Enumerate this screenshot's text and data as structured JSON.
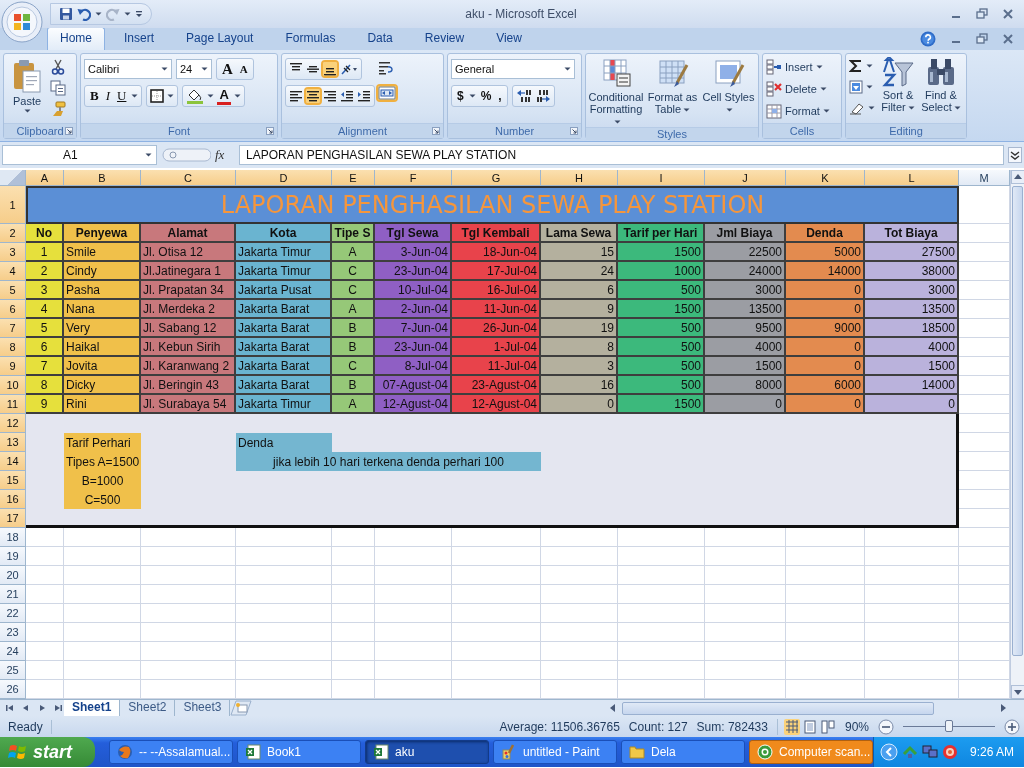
{
  "window": {
    "title": "aku - Microsoft Excel"
  },
  "tabs": [
    {
      "label": "Home",
      "selected": true
    },
    {
      "label": "Insert",
      "selected": false
    },
    {
      "label": "Page Layout",
      "selected": false
    },
    {
      "label": "Formulas",
      "selected": false
    },
    {
      "label": "Data",
      "selected": false
    },
    {
      "label": "Review",
      "selected": false
    },
    {
      "label": "View",
      "selected": false
    }
  ],
  "ribbon": {
    "groups": [
      {
        "kind": "clipboard",
        "label": "Clipboard",
        "paste": "Paste"
      },
      {
        "kind": "font",
        "label": "Font",
        "font_name": "Calibri",
        "font_size": "24",
        "grow": "A",
        "shrink": "A",
        "styles": [
          "B",
          "I",
          "U"
        ],
        "font_color": "A"
      },
      {
        "kind": "alignment",
        "label": "Alignment",
        "rows": [
          [
            {
              "kind": "top",
              "selected": false
            },
            {
              "kind": "middle",
              "selected": false
            },
            {
              "kind": "bottom",
              "selected": true
            },
            {
              "kind": "orientation",
              "selected": false
            }
          ],
          [
            {
              "kind": "left",
              "selected": false
            },
            {
              "kind": "center",
              "selected": true
            },
            {
              "kind": "right",
              "selected": false
            },
            {
              "kind": "outdent",
              "selected": false
            },
            {
              "kind": "indent",
              "selected": false
            }
          ]
        ],
        "side": [
          {
            "kind": "wrap",
            "selected": false
          },
          {
            "kind": "merge",
            "selected": true
          }
        ]
      },
      {
        "kind": "number",
        "label": "Number",
        "format": "General",
        "symbols": [
          "$",
          "%",
          ","
        ]
      },
      {
        "kind": "styles",
        "label": "Styles",
        "buttons": [
          {
            "kind": "conditional",
            "label": "Conditional Formatting"
          },
          {
            "kind": "table",
            "label": "Format as Table"
          },
          {
            "kind": "cellstyle",
            "label": "Cell Styles"
          }
        ]
      },
      {
        "kind": "cells",
        "label": "Cells",
        "buttons": [
          {
            "kind": "insert",
            "label": "Insert"
          },
          {
            "kind": "delete",
            "label": "Delete"
          },
          {
            "kind": "format",
            "label": "Format"
          }
        ]
      },
      {
        "kind": "editing",
        "label": "Editing",
        "buttons": [
          {
            "kind": "sort",
            "label": "Sort & Filter"
          },
          {
            "kind": "find",
            "label": "Find & Select"
          }
        ]
      }
    ]
  },
  "formula_bar": {
    "name_box": "A1",
    "function_label": "fx",
    "formula": "LAPORAN PENGHASILAN SEWA PLAY STATION"
  },
  "sheet": {
    "columns": [
      {
        "label": "A",
        "highlighted": true
      },
      {
        "label": "B",
        "highlighted": true
      },
      {
        "label": "C",
        "highlighted": true
      },
      {
        "label": "D",
        "highlighted": true
      },
      {
        "label": "E",
        "highlighted": true
      },
      {
        "label": "F",
        "highlighted": true
      },
      {
        "label": "G",
        "highlighted": true
      },
      {
        "label": "H",
        "highlighted": true
      },
      {
        "label": "I",
        "highlighted": true
      },
      {
        "label": "J",
        "highlighted": true
      },
      {
        "label": "K",
        "highlighted": true
      },
      {
        "label": "L",
        "highlighted": true
      },
      {
        "label": "M",
        "highlighted": false
      }
    ],
    "rows": [
      {
        "label": "1",
        "highlighted": true
      },
      {
        "label": "2",
        "highlighted": true
      },
      {
        "label": "3",
        "highlighted": true
      },
      {
        "label": "4",
        "highlighted": true
      },
      {
        "label": "5",
        "highlighted": true
      },
      {
        "label": "6",
        "highlighted": true
      },
      {
        "label": "7",
        "highlighted": true
      },
      {
        "label": "8",
        "highlighted": true
      },
      {
        "label": "9",
        "highlighted": true
      },
      {
        "label": "10",
        "highlighted": true
      },
      {
        "label": "11",
        "highlighted": true
      },
      {
        "label": "12",
        "highlighted": true
      },
      {
        "label": "13",
        "highlighted": true
      },
      {
        "label": "14",
        "highlighted": true
      },
      {
        "label": "15",
        "highlighted": true
      },
      {
        "label": "16",
        "highlighted": true
      },
      {
        "label": "17",
        "highlighted": true
      },
      {
        "label": "18",
        "highlighted": false
      },
      {
        "label": "19",
        "highlighted": false
      },
      {
        "label": "20",
        "highlighted": false
      },
      {
        "label": "21",
        "highlighted": false
      },
      {
        "label": "22",
        "highlighted": false
      },
      {
        "label": "23",
        "highlighted": false
      },
      {
        "label": "24",
        "highlighted": false
      },
      {
        "label": "25",
        "highlighted": false
      },
      {
        "label": "26",
        "highlighted": false
      }
    ],
    "title": "LAPORAN PENGHASILAN SEWA PLAY STATION",
    "table": {
      "columns": [
        {
          "header": "No",
          "color": "#e6e03c",
          "kind": "index"
        },
        {
          "header": "Penyewa",
          "color": "#f0c04a",
          "kind": "text"
        },
        {
          "header": "Alamat",
          "color": "#c8787c",
          "kind": "text"
        },
        {
          "header": "Kota",
          "color": "#6ab4d0",
          "kind": "text"
        },
        {
          "header": "Tipe S",
          "color": "#96c878",
          "kind": "code"
        },
        {
          "header": "Tgl Sewa",
          "color": "#8f5fc4",
          "kind": "date"
        },
        {
          "header": "Tgl Kembali",
          "color": "#e8434b",
          "kind": "date"
        },
        {
          "header": "Lama Sewa",
          "color": "#b4b09e",
          "kind": "number"
        },
        {
          "header": "Tarif per Hari",
          "color": "#3cb97c",
          "kind": "number"
        },
        {
          "header": "Jml Biaya",
          "color": "#9b9da3",
          "kind": "number"
        },
        {
          "header": "Denda",
          "color": "#e38b4f",
          "kind": "number"
        },
        {
          "header": "Tot Biaya",
          "color": "#bab2dc",
          "kind": "number"
        }
      ],
      "rows": [
        [
          "1",
          "Smile",
          "Jl. Otisa 12",
          "Jakarta Timur",
          "A",
          "3-Jun-04",
          "18-Jun-04",
          "15",
          "1500",
          "22500",
          "5000",
          "27500"
        ],
        [
          "2",
          "Cindy",
          "Jl.Jatinegara 1",
          "Jakarta Timur",
          "C",
          "23-Jun-04",
          "17-Jul-04",
          "24",
          "1000",
          "24000",
          "14000",
          "38000"
        ],
        [
          "3",
          "Pasha",
          "Jl. Prapatan 34",
          "Jakarta Pusat",
          "C",
          "10-Jul-04",
          "16-Jul-04",
          "6",
          "500",
          "3000",
          "0",
          "3000"
        ],
        [
          "4",
          "Nana",
          "Jl. Merdeka 2",
          "Jakarta Barat",
          "A",
          "2-Jun-04",
          "11-Jun-04",
          "9",
          "1500",
          "13500",
          "0",
          "13500"
        ],
        [
          "5",
          "Very",
          "Jl. Sabang 12",
          "Jakarta Barat",
          "B",
          "7-Jun-04",
          "26-Jun-04",
          "19",
          "500",
          "9500",
          "9000",
          "18500"
        ],
        [
          "6",
          "Haikal",
          "Jl. Kebun Sirih",
          "Jakarta Barat",
          "B",
          "23-Jun-04",
          "1-Jul-04",
          "8",
          "500",
          "4000",
          "0",
          "4000"
        ],
        [
          "7",
          "Jovita",
          "Jl. Karanwang 2",
          "Jakarta Barat",
          "C",
          "8-Jul-04",
          "11-Jul-04",
          "3",
          "500",
          "1500",
          "0",
          "1500"
        ],
        [
          "8",
          "Dicky",
          "Jl. Beringin 43",
          "Jakarta Barat",
          "B",
          "07-Agust-04",
          "23-Agust-04",
          "16",
          "500",
          "8000",
          "6000",
          "14000"
        ],
        [
          "9",
          "Rini",
          "Jl. Surabaya 54",
          "Jakarta Timur",
          "A",
          "12-Agust-04",
          "12-Agust-04",
          "0",
          "1500",
          "0",
          "0",
          "0"
        ]
      ]
    },
    "rate_note": {
      "title": "Tarif Perhari",
      "lines": [
        "Tipes A=1500",
        "B=1000",
        "C=500"
      ]
    },
    "fine_note": {
      "title": "Denda",
      "text": "jika lebih 10 hari terkena denda perhari 100"
    }
  },
  "sheet_tabs": [
    {
      "label": "Sheet1",
      "selected": true
    },
    {
      "label": "Sheet2",
      "selected": false
    },
    {
      "label": "Sheet3",
      "selected": false
    }
  ],
  "status_bar": {
    "mode": "Ready",
    "average": "Average: 11506.36765",
    "count": "Count: 127",
    "sum": "Sum: 782433",
    "views": [
      {
        "kind": "normal",
        "selected": true
      },
      {
        "kind": "layout",
        "selected": false
      },
      {
        "kind": "break",
        "selected": false
      }
    ],
    "zoom": "90%",
    "zoom_slider": {
      "level": 0.5
    }
  },
  "taskbar": {
    "start": "start",
    "items": [
      {
        "kind": "browser",
        "label": "-- --Assalamual...",
        "selected": false,
        "flashing": false
      },
      {
        "kind": "excel",
        "label": "Book1",
        "selected": false,
        "flashing": false
      },
      {
        "kind": "excel",
        "label": "aku",
        "selected": true,
        "flashing": false
      },
      {
        "kind": "paint",
        "label": "untitled - Paint",
        "selected": false,
        "flashing": false
      },
      {
        "kind": "folder",
        "label": "Dela",
        "selected": false,
        "flashing": false
      },
      {
        "kind": "scanner",
        "label": "Computer scan...",
        "selected": false,
        "flashing": true
      }
    ],
    "clock": "9:26 AM"
  }
}
